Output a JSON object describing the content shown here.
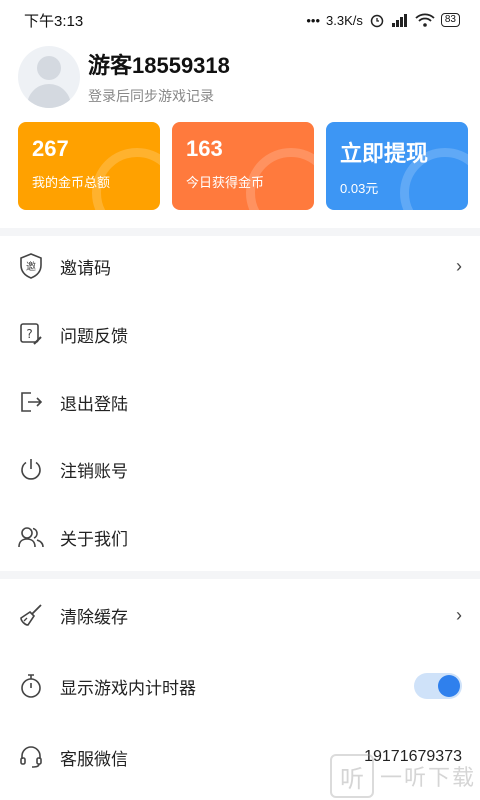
{
  "status_bar": {
    "time": "下午3:13",
    "network_speed": "3.3K/s",
    "battery": "83"
  },
  "profile": {
    "username": "游客18559318",
    "subtitle": "登录后同步游戏记录"
  },
  "cards": [
    {
      "value": "267",
      "label": "我的金币总额",
      "color": "#FFA100"
    },
    {
      "value": "163",
      "label": "今日获得金币",
      "color": "#FF7A3D"
    },
    {
      "value": "立即提现",
      "label": "0.03元",
      "color": "#3D96F4"
    }
  ],
  "menu_group1": [
    {
      "label": "邀请码",
      "icon": "shield-invite-icon",
      "has_chevron": true
    },
    {
      "label": "问题反馈",
      "icon": "feedback-icon"
    },
    {
      "label": "退出登陆",
      "icon": "logout-icon"
    },
    {
      "label": "注销账号",
      "icon": "power-icon"
    },
    {
      "label": "关于我们",
      "icon": "users-icon"
    }
  ],
  "menu_group2": [
    {
      "label": "清除缓存",
      "icon": "broom-icon",
      "has_chevron": true
    },
    {
      "label": "显示游戏内计时器",
      "icon": "stopwatch-icon",
      "toggle_on": true
    },
    {
      "label": "客服微信",
      "icon": "headset-icon",
      "value": "19171679373"
    }
  ],
  "watermark": {
    "glyph": "听",
    "text": "一听下载"
  }
}
